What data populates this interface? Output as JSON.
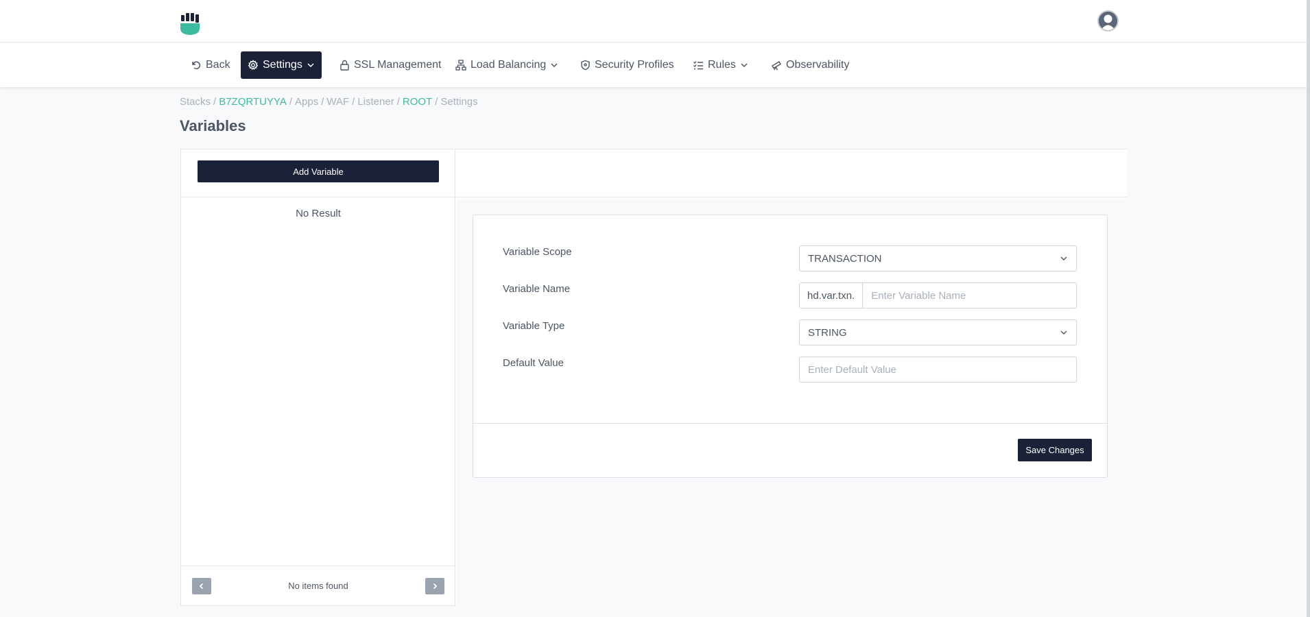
{
  "colors": {
    "accent": "#3dbba0",
    "primary": "#1b2238",
    "text": "#4b5563",
    "muted": "#a8b0bb"
  },
  "header": {
    "logo_icon": "fist-shield-logo",
    "avatar_icon": "user-avatar-icon"
  },
  "nav": {
    "items": [
      {
        "label": "Back",
        "icon": "undo-icon",
        "dropdown": false,
        "active": false
      },
      {
        "label": "Settings",
        "icon": "gear-icon",
        "dropdown": true,
        "active": true
      },
      {
        "label": "SSL Management",
        "icon": "lock-icon",
        "dropdown": false,
        "active": false
      },
      {
        "label": "Load Balancing",
        "icon": "network-icon",
        "dropdown": true,
        "active": false
      },
      {
        "label": "Security Profiles",
        "icon": "shield-icon",
        "dropdown": false,
        "active": false
      },
      {
        "label": "Rules",
        "icon": "checklist-icon",
        "dropdown": true,
        "active": false
      },
      {
        "label": "Observability",
        "icon": "telescope-icon",
        "dropdown": false,
        "active": false
      }
    ]
  },
  "breadcrumb": {
    "items": [
      {
        "label": "Stacks",
        "link": false
      },
      {
        "label": "B7ZQRTUYYA",
        "link": true
      },
      {
        "label": "Apps",
        "link": false
      },
      {
        "label": "WAF",
        "link": false
      },
      {
        "label": "Listener",
        "link": false
      },
      {
        "label": "ROOT",
        "link": true
      },
      {
        "label": "Settings",
        "link": false
      }
    ],
    "separator": "/"
  },
  "page": {
    "title": "Variables"
  },
  "left_panel": {
    "add_button_label": "Add Variable",
    "empty_text": "No Result",
    "pagination_text": "No items found"
  },
  "form": {
    "scope": {
      "label": "Variable Scope",
      "value": "TRANSACTION"
    },
    "name": {
      "label": "Variable Name",
      "prefix": "hd.var.txn.",
      "placeholder": "Enter Variable Name",
      "value": ""
    },
    "type": {
      "label": "Variable Type",
      "value": "STRING"
    },
    "default": {
      "label": "Default Value",
      "placeholder": "Enter Default Value",
      "value": ""
    },
    "save_label": "Save Changes"
  }
}
